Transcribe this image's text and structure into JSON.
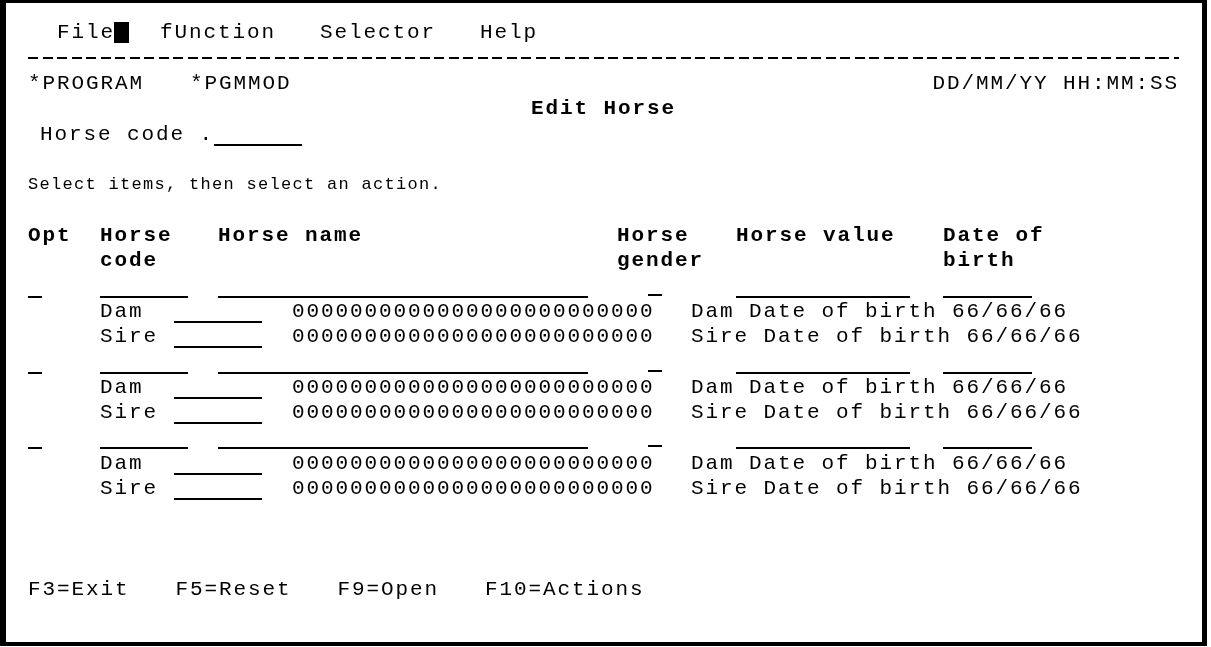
{
  "menu": [
    {
      "label": "File",
      "cursor": true
    },
    {
      "label": "fUnction",
      "cursor": false
    },
    {
      "label": "Selector",
      "cursor": false
    },
    {
      "label": "Help",
      "cursor": false
    }
  ],
  "header": {
    "program": "*PROGRAM",
    "module": "*PGMMOD",
    "date_time": "DD/MM/YY HH:MM:SS"
  },
  "title": "Edit Horse",
  "filter": {
    "label": "Horse code ."
  },
  "instruction": "Select items, then select an action.",
  "table": {
    "columns": [
      "Opt",
      "Horse code",
      "Horse name",
      "Horse gender",
      "Horse value",
      "Date of birth"
    ],
    "rows": [
      {
        "parents": [
          {
            "label": "Dam",
            "name": "0000000000000000000000000",
            "dob_label": "Dam Date of birth",
            "dob": "66/66/66"
          },
          {
            "label": "Sire",
            "name": "0000000000000000000000000",
            "dob_label": "Sire Date of birth",
            "dob": "66/66/66"
          }
        ]
      },
      {
        "parents": [
          {
            "label": "Dam",
            "name": "0000000000000000000000000",
            "dob_label": "Dam Date of birth",
            "dob": "66/66/66"
          },
          {
            "label": "Sire",
            "name": "0000000000000000000000000",
            "dob_label": "Sire Date of birth",
            "dob": "66/66/66"
          }
        ]
      },
      {
        "parents": [
          {
            "label": "Dam",
            "name": "0000000000000000000000000",
            "dob_label": "Dam Date of birth",
            "dob": "66/66/66"
          },
          {
            "label": "Sire",
            "name": "0000000000000000000000000",
            "dob_label": "Sire Date of birth",
            "dob": "66/66/66"
          }
        ]
      }
    ]
  },
  "function_keys": [
    "F3=Exit",
    "F5=Reset",
    "F9=Open",
    "F10=Actions"
  ]
}
